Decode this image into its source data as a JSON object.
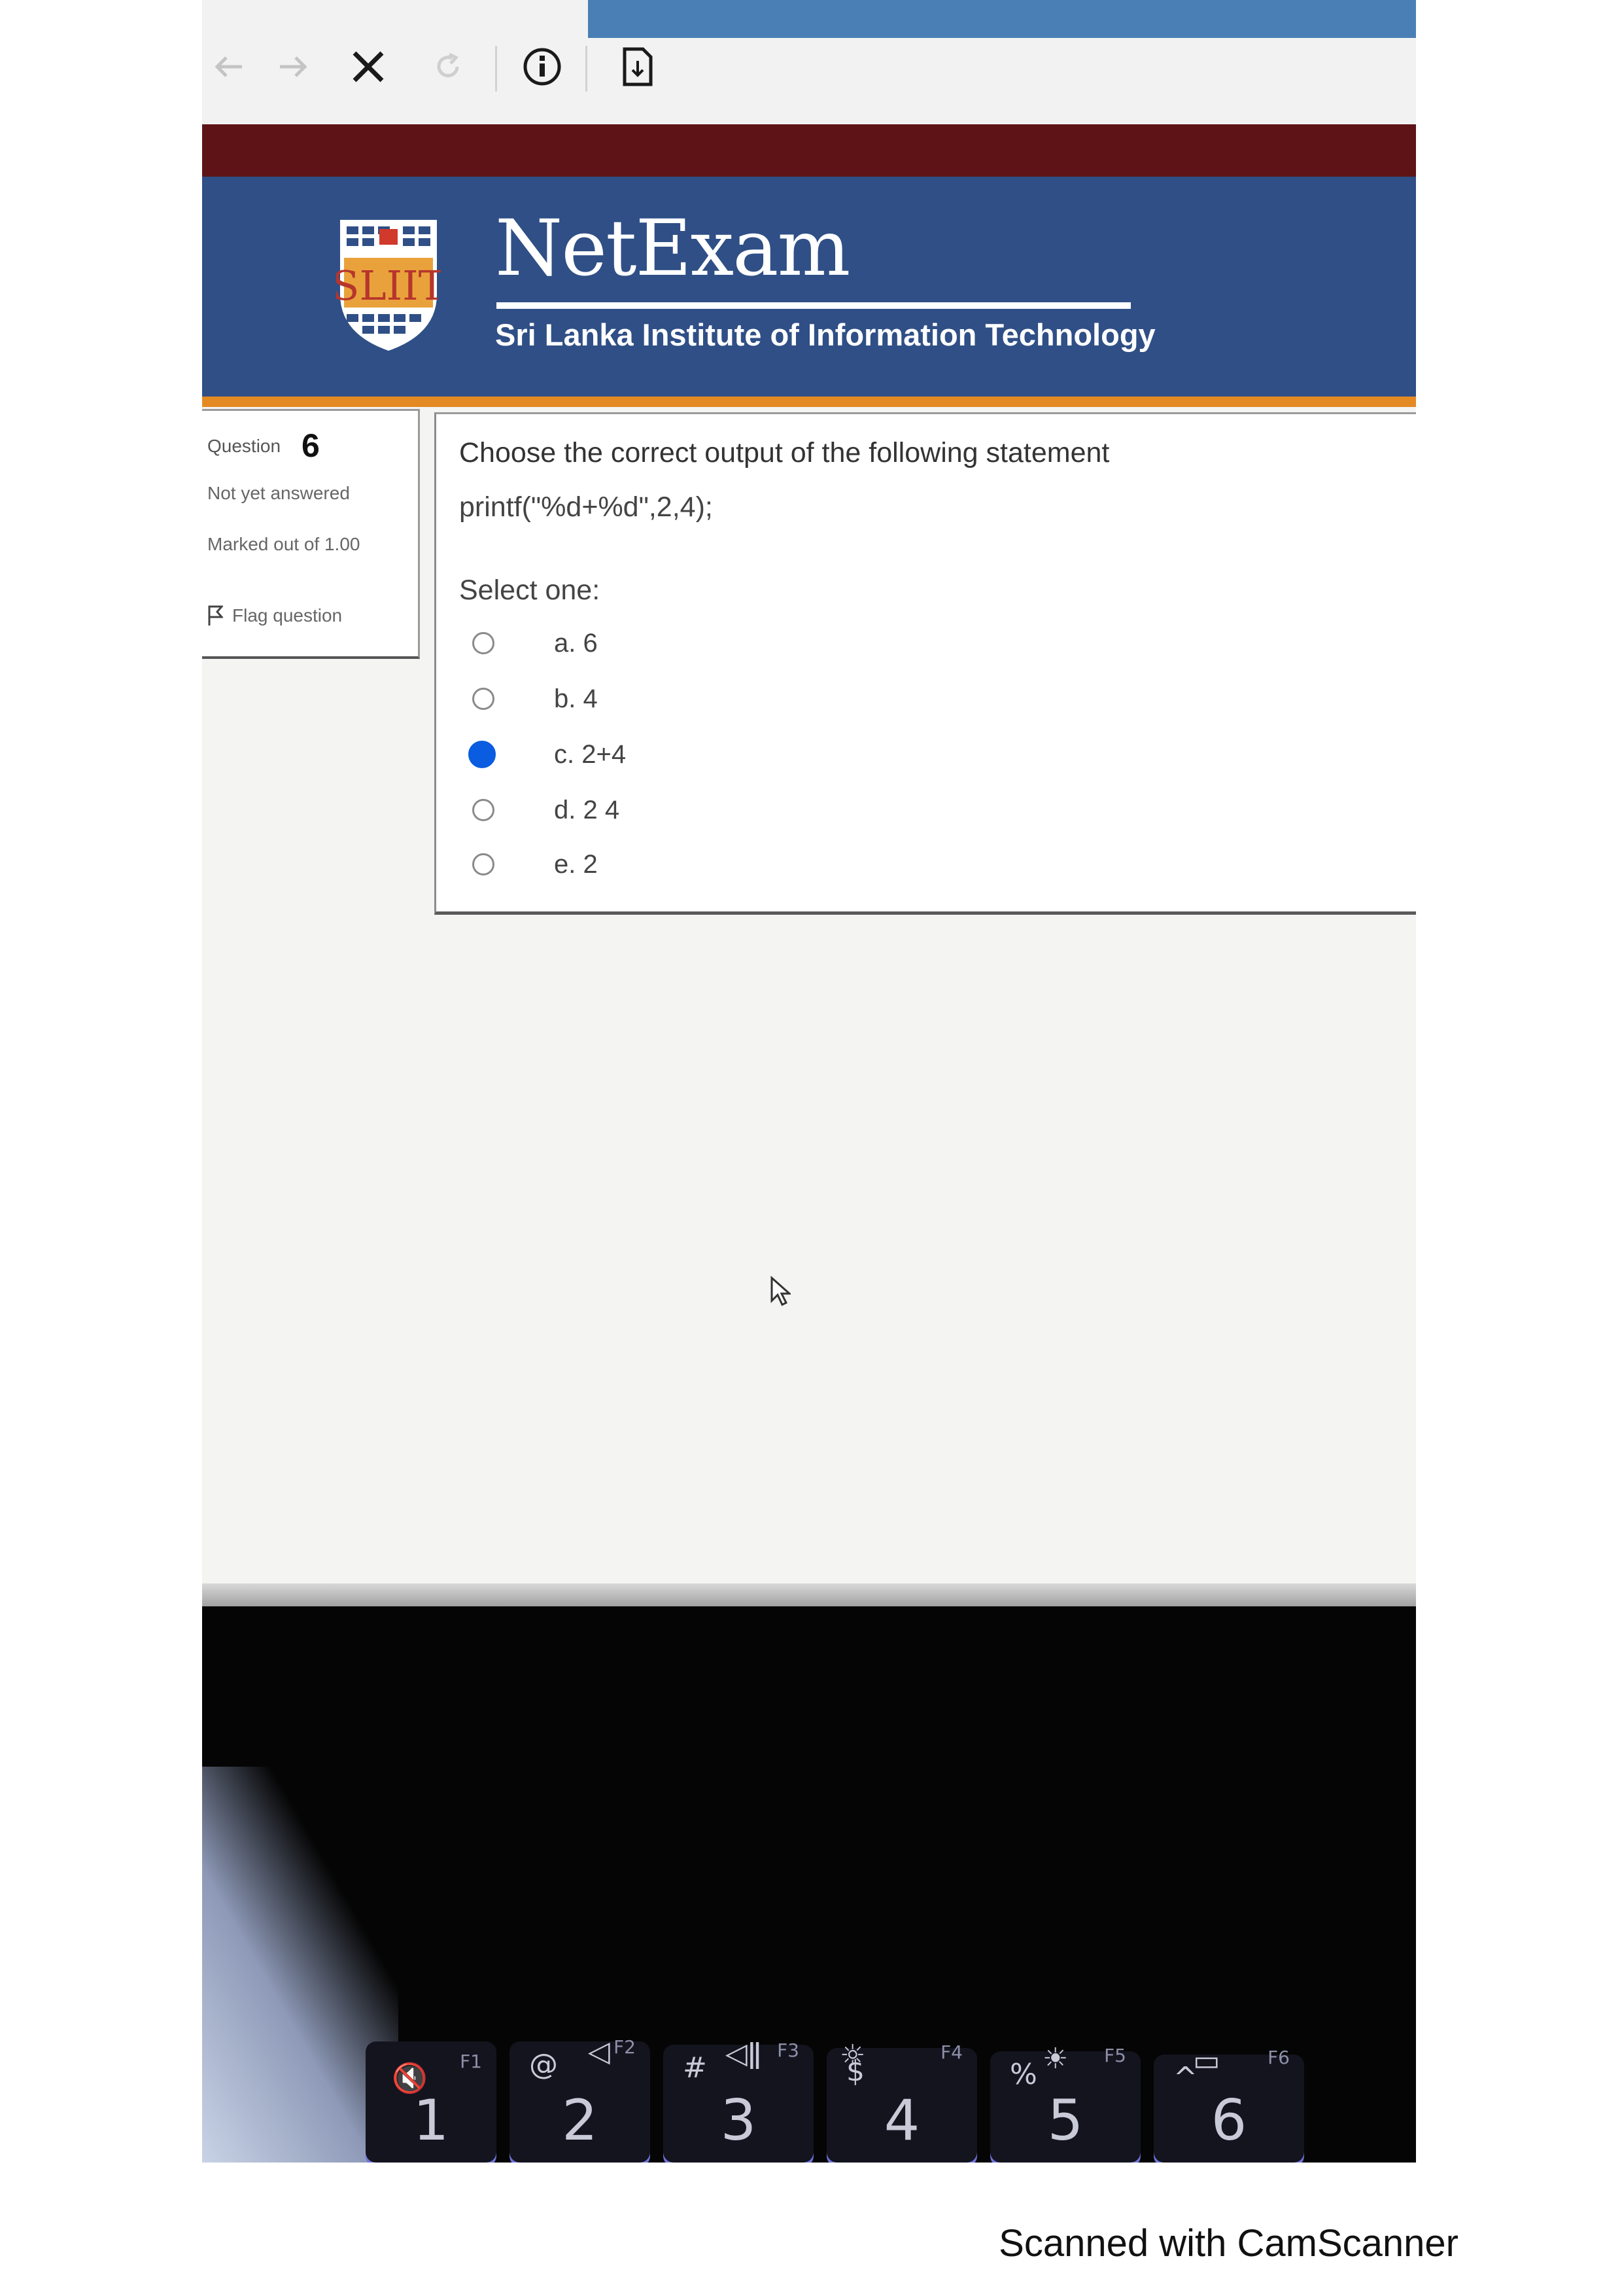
{
  "browser": {
    "back_icon": "arrow-left-icon",
    "forward_icon": "arrow-right-icon",
    "stop_icon": "close-icon",
    "reload_icon": "reload-icon",
    "info_icon": "info-icon",
    "page_icon": "document-icon"
  },
  "header": {
    "logo_text": "SLIIT",
    "brand_title": "NetExam",
    "brand_subtitle": "Sri Lanka Institute of Information Technology"
  },
  "question_info": {
    "label": "Question",
    "number": "6",
    "state": "Not yet answered",
    "marked": "Marked out of 1.00",
    "flag_label": "Flag question"
  },
  "question": {
    "text": "Choose the correct output of the following statement",
    "code": "printf(\"%d+%d\",2,4);",
    "select_label": "Select one:",
    "options": [
      {
        "label": "a. 6",
        "checked": false
      },
      {
        "label": "b. 4",
        "checked": false
      },
      {
        "label": "c. 2+4",
        "checked": true
      },
      {
        "label": "d. 2 4",
        "checked": false
      },
      {
        "label": "e. 2",
        "checked": false
      }
    ]
  },
  "keyboard": {
    "keys": [
      {
        "main": "1",
        "fn": "F1",
        "ico": "🔇"
      },
      {
        "main": "2",
        "sub": "@",
        "fn": "F2",
        "ico": "◁"
      },
      {
        "main": "3",
        "sub": "#",
        "fn": "F3",
        "ico": "◁ǁ"
      },
      {
        "main": "4",
        "sub": "$",
        "fn": "F4",
        "ico": "☼"
      },
      {
        "main": "5",
        "sub": "%",
        "fn": "F5",
        "ico": "☀"
      },
      {
        "main": "6",
        "sub": "^",
        "fn": "F6",
        "ico": "▭"
      }
    ]
  },
  "footer": {
    "text": "Scanned with CamScanner"
  }
}
